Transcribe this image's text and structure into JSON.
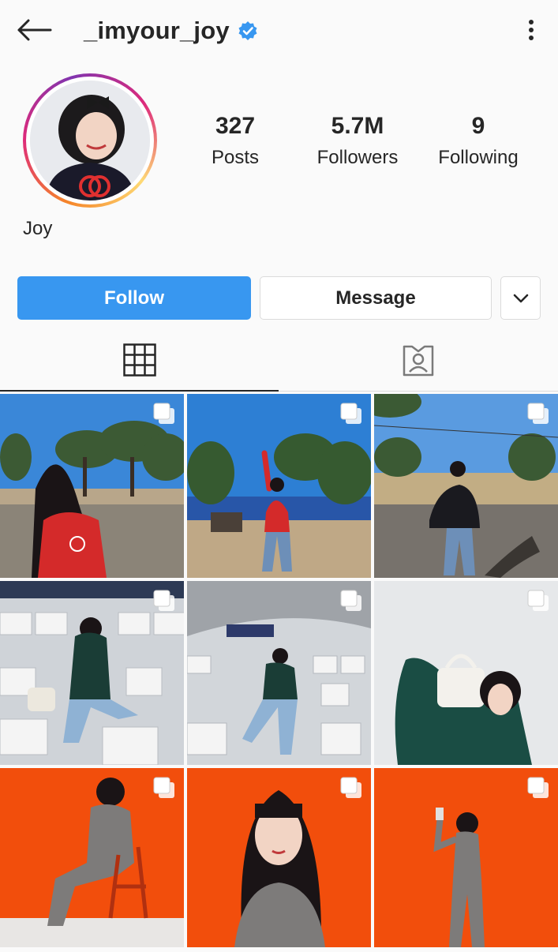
{
  "header": {
    "back_icon": "arrow-left-icon",
    "username": "_imyour_joy",
    "verified_icon": "verified-badge-icon",
    "more_icon": "vertical-dots-icon"
  },
  "profile": {
    "display_name": "Joy",
    "stats": [
      {
        "value": "327",
        "label": "Posts"
      },
      {
        "value": "5.7M",
        "label": "Followers"
      },
      {
        "value": "9",
        "label": "Following"
      }
    ]
  },
  "actions": {
    "follow_label": "Follow",
    "message_label": "Message",
    "dropdown_icon": "chevron-down-icon"
  },
  "tabs": [
    {
      "name": "grid",
      "icon": "grid-icon",
      "active": true
    },
    {
      "name": "tagged",
      "icon": "tagged-person-icon",
      "active": false
    }
  ],
  "posts": [
    {
      "scene": "outdoor-field-red-sweater",
      "multi": true
    },
    {
      "scene": "outdoor-trees-peace-sign",
      "multi": true
    },
    {
      "scene": "outdoor-road-black-bag",
      "multi": true
    },
    {
      "scene": "stadium-seated-green-sweater",
      "multi": true
    },
    {
      "scene": "stadium-standing-green-sweater",
      "multi": true
    },
    {
      "scene": "white-wall-white-bag",
      "multi": true
    },
    {
      "scene": "orange-backdrop-chair",
      "multi": true
    },
    {
      "scene": "orange-backdrop-portrait",
      "multi": true
    },
    {
      "scene": "orange-backdrop-full-body",
      "multi": true
    }
  ],
  "colors": {
    "primary_blue": "#3897f0",
    "verified_blue": "#3897f0",
    "text": "#262626",
    "border": "#dbdbdb",
    "background": "#fafafa"
  }
}
